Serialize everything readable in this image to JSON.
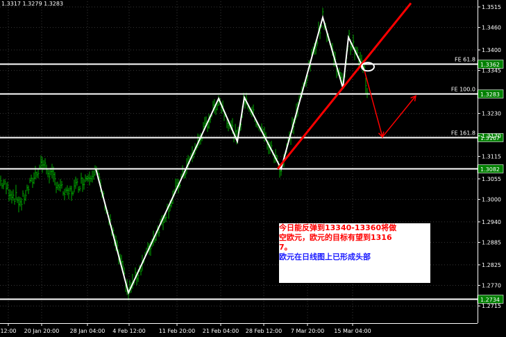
{
  "ohlc_header": "1.3317 1.3279 1.3283",
  "annotation": {
    "line1": "今日能反弹到13340-13360将做",
    "line2": "空欧元，欧元的目标有望到1316",
    "line3": "7。",
    "line4": "欧元在日线图上已形成头部"
  },
  "colors": {
    "background": "#000000",
    "bars": "#00aa00",
    "zigzag": "#ffffff",
    "trendline": "#ff0000",
    "level_lines": "#ffffff",
    "price_box": "#008000"
  },
  "chart_data": {
    "type": "line",
    "x_tick_labels": [
      "12:00",
      "20 Jan 20:00",
      "28 Jan 04:00",
      "4 Feb 12:00",
      "11 Feb 20:00",
      "21 Feb 04:00",
      "28 Feb 12:00",
      "7 Mar 20:00",
      "15 Mar 04:00"
    ],
    "y_tick_labels": [
      "1.3515",
      "1.3460",
      "1.3400",
      "1.3345",
      "1.3230",
      "1.3170",
      "1.3115",
      "1.3055",
      "1.3000",
      "1.2940",
      "1.2885",
      "1.2825",
      "1.2770",
      "1.2715"
    ],
    "ylim": [
      1.2702,
      1.3525
    ],
    "price_levels": [
      {
        "label": "FE 61.8",
        "value": 1.3362
      },
      {
        "label": "FE 100.0",
        "value": 1.3283
      },
      {
        "label": "FE 161.8",
        "value": 1.3167
      },
      {
        "label": "",
        "value": 1.3082
      },
      {
        "label": "",
        "value": 1.2734
      }
    ],
    "zigzag": [
      {
        "bar": 138,
        "price": 1.3082
      },
      {
        "bar": 185,
        "price": 1.275
      },
      {
        "bar": 315,
        "price": 1.327
      },
      {
        "bar": 342,
        "price": 1.3155
      },
      {
        "bar": 352,
        "price": 1.3273
      },
      {
        "bar": 405,
        "price": 1.3082
      },
      {
        "bar": 465,
        "price": 1.3487
      },
      {
        "bar": 494,
        "price": 1.3298
      },
      {
        "bar": 502,
        "price": 1.3434
      },
      {
        "bar": 525,
        "price": 1.3345
      }
    ],
    "projection": [
      {
        "bar": 525,
        "price": 1.3345
      },
      {
        "bar": 551,
        "price": 1.3167
      },
      {
        "bar": 599,
        "price": 1.3277
      }
    ],
    "trendline": [
      {
        "bar": 400,
        "price": 1.3082
      },
      {
        "bar": 592,
        "price": 1.3525
      }
    ],
    "marker": {
      "bar": 530,
      "price": 1.3355
    }
  }
}
